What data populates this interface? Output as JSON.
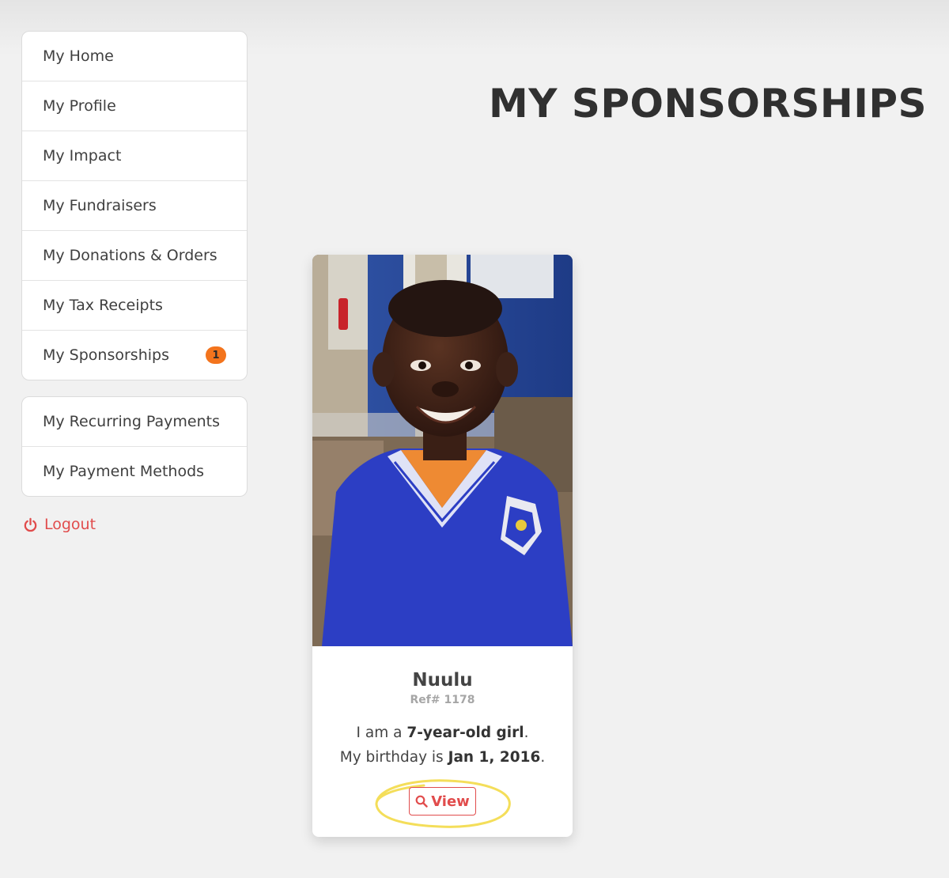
{
  "sidebar": {
    "primary_items": [
      {
        "label": "My Home"
      },
      {
        "label": "My Profile"
      },
      {
        "label": "My Impact"
      },
      {
        "label": "My Fundraisers"
      },
      {
        "label": "My Donations & Orders"
      },
      {
        "label": "My Tax Receipts"
      },
      {
        "label": "My Sponsorships",
        "badge": "1"
      }
    ],
    "secondary_items": [
      {
        "label": "My Recurring Payments"
      },
      {
        "label": "My Payment Methods"
      }
    ],
    "logout_label": "Logout",
    "logout_icon": "power-icon",
    "badge_color": "#f3741d"
  },
  "main": {
    "title": "MY SPONSORSHIPS",
    "cards": [
      {
        "name": "Nuulu",
        "ref": "Ref# 1178",
        "age_prefix": "I am a ",
        "age_text": "7-year-old girl",
        "age_suffix": ".",
        "birthday_prefix": "My birthday is ",
        "birthday_value": "Jan 1, 2016",
        "birthday_suffix": ".",
        "view_label": "View",
        "view_icon": "search-icon"
      }
    ]
  },
  "colors": {
    "accent": "#e14c4c",
    "highlight_circle": "#f4de5a"
  }
}
